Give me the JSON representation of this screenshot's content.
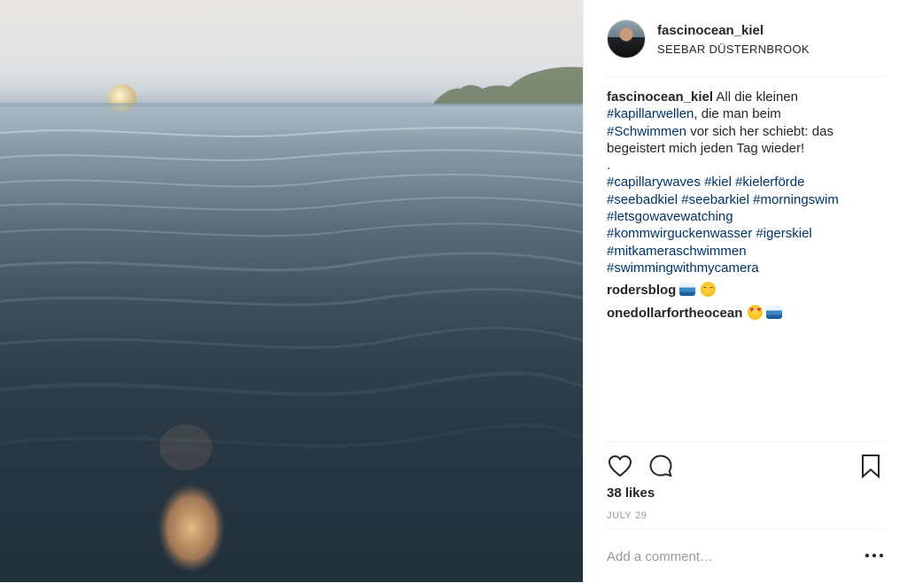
{
  "post": {
    "username": "fascinocean_kiel",
    "location": "SEEBAR DÜSTERNBROOK",
    "caption": {
      "user": "fascinocean_kiel",
      "t1": " All die kleinen ",
      "tag1": "#kapillarwellen",
      "t2": ", die man beim ",
      "tag2": "#Schwimmen",
      "t3": " vor sich her schiebt: das begeistert mich jeden Tag wieder!",
      "dot": ".",
      "hashtags": [
        "#capillarywaves",
        "#kiel",
        "#kielerförde",
        "#seebadkiel",
        "#seebarkiel",
        "#morningswim",
        "#letsgowavewatching",
        "#kommwirguckenwasser",
        "#igerskiel",
        "#mitkameraschwimmen",
        "#swimmingwithmycamera"
      ]
    },
    "comments": [
      {
        "user": "rodersblog"
      },
      {
        "user": "onedollarfortheocean"
      }
    ],
    "likes": "38 likes",
    "date": "JULY 29",
    "add_comment_placeholder": "Add a comment…"
  },
  "icons": {
    "like": "heart-icon",
    "comment": "comment-icon",
    "save": "bookmark-icon",
    "more": "more-dots-icon"
  },
  "colors": {
    "hashtag": "#003569",
    "text": "#262626",
    "muted": "#999999",
    "divider": "#efefef"
  }
}
